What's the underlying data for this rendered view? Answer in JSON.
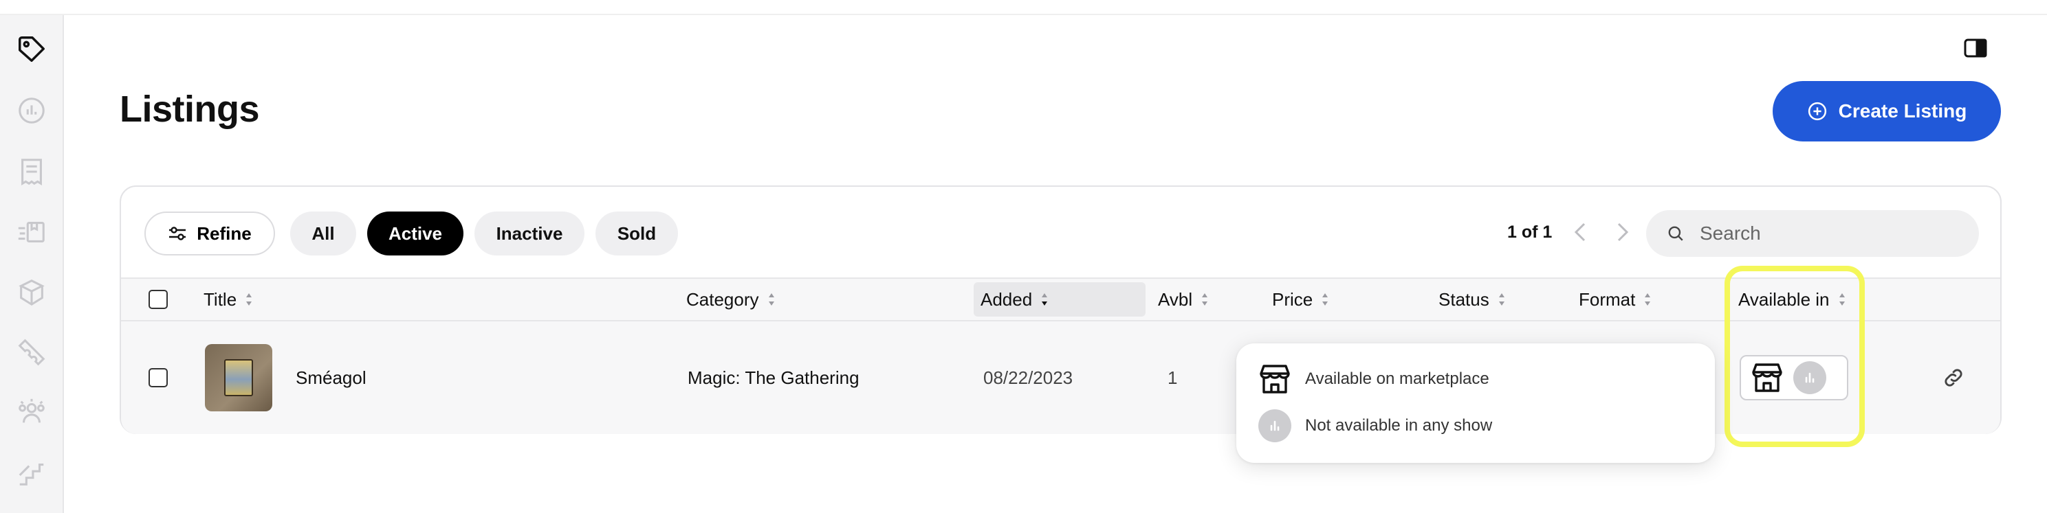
{
  "page": {
    "title": "Listings"
  },
  "header": {
    "create_label": "Create Listing"
  },
  "sidebar": {
    "items": [
      {
        "icon": "tag-icon"
      },
      {
        "icon": "analytics-icon"
      },
      {
        "icon": "receipt-icon"
      },
      {
        "icon": "shipping-icon"
      },
      {
        "icon": "bundle-icon"
      },
      {
        "icon": "ticket-icon"
      },
      {
        "icon": "community-icon"
      },
      {
        "icon": "growth-icon"
      }
    ]
  },
  "filters": {
    "refine_label": "Refine",
    "chips": [
      "All",
      "Active",
      "Inactive",
      "Sold"
    ],
    "active_chip": "Active"
  },
  "pagination": {
    "label": "1 of 1"
  },
  "search": {
    "placeholder": "Search"
  },
  "table": {
    "columns": [
      "Title",
      "Category",
      "Added",
      "Avbl",
      "Price",
      "Status",
      "Format",
      "Available in"
    ],
    "rows": [
      {
        "title": "Sméagol",
        "category": "Magic: The Gathering",
        "added": "08/22/2023",
        "avbl": "1"
      }
    ]
  },
  "tooltip": {
    "marketplace": "Available on marketplace",
    "show": "Not available in any show"
  },
  "colors": {
    "primary": "#2159d9",
    "highlight": "#f4f75a",
    "active_chip_bg": "#000000"
  }
}
